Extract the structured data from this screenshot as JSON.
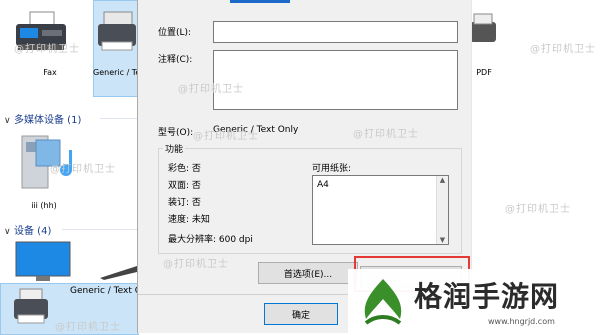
{
  "explorer": {
    "devices_top": [
      {
        "label": "Fax",
        "icon": "fax-printer-icon"
      },
      {
        "label": "Generic / Text Only",
        "icon": "printer-icon"
      },
      {
        "label": "PDF",
        "icon": "printer-icon"
      }
    ],
    "multimedia_section": "多媒体设备 (1)",
    "media_device_label": "iii (hh)",
    "devices_section": "设备 (4)",
    "bottom_printer_label": "Generic / Text O"
  },
  "dialog": {
    "location_label": "位置(L):",
    "location_value": "",
    "comment_label": "注释(C):",
    "comment_value": "",
    "model_label": "型号(O):",
    "model_value": "Generic / Text Only",
    "features_group": "功能",
    "features": [
      "彩色: 否",
      "双面: 否",
      "装订: 否",
      "速度: 未知",
      "最大分辨率: 600 dpi"
    ],
    "paper_label": "可用纸张:",
    "paper_items": [
      "A4"
    ],
    "preferences_button": "首选项(E)...",
    "print_test_button": "",
    "ok_button": "确定"
  },
  "watermark": "@打印机卫士",
  "brand": {
    "name": "格润手游网",
    "url": "www.hngrjd.com"
  },
  "colors": {
    "highlight": "#e53935",
    "brand_green": "#3a8f2a",
    "section": "#1a3e8c"
  }
}
